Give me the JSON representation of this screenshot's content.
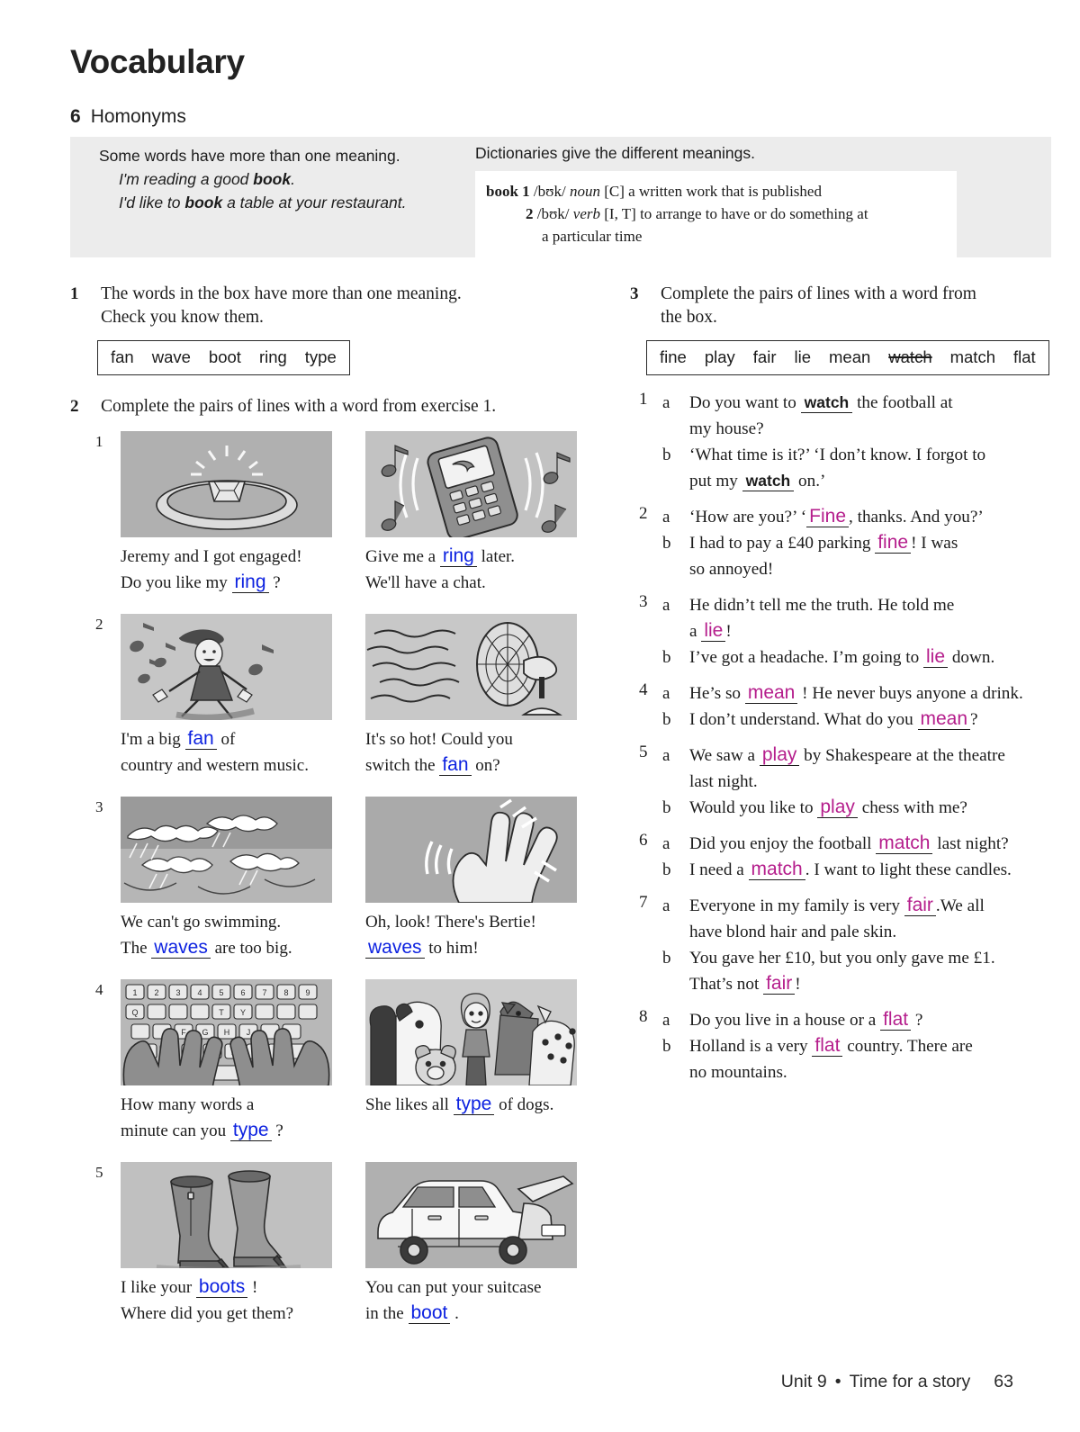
{
  "page": {
    "title": "Vocabulary",
    "section_number": "6",
    "section_title": "Homonyms",
    "footer_unit": "Unit 9",
    "footer_dot": "•",
    "footer_title": "Time for a story",
    "footer_page": "63"
  },
  "presentation": {
    "intro": "Some words have more than one meaning.",
    "example_1_pre": "I'm reading a good ",
    "example_1_bold": "book",
    "example_1_post": ".",
    "example_2_pre": "I'd like to ",
    "example_2_bold": "book",
    "example_2_post": " a table at your restaurant.",
    "dict_intro": "Dictionaries give the different meanings.",
    "dict": {
      "headword": "book",
      "sense1_num": "1",
      "sense1_ipa": "/bʊk/",
      "sense1_pos": "noun",
      "sense1_codes": "[C]",
      "sense1_def": "a written work that is published",
      "sense2_num": "2",
      "sense2_ipa": "/bʊk/",
      "sense2_pos": "verb",
      "sense2_codes": "[I, T]",
      "sense2_def": "to arrange to have or do something at",
      "sense2_def_cont": "a particular time"
    }
  },
  "exercise1": {
    "number": "1",
    "instruction_line1": "The words in the box have more than one meaning.",
    "instruction_line2": "Check you know them.",
    "words": [
      {
        "text": "fan",
        "struck": false
      },
      {
        "text": "wave",
        "struck": false
      },
      {
        "text": "boot",
        "struck": false
      },
      {
        "text": "ring",
        "struck": false
      },
      {
        "text": "type",
        "struck": false
      }
    ]
  },
  "exercise2": {
    "number": "2",
    "instruction": "Complete the pairs of lines with a word from exercise 1.",
    "rows": [
      {
        "row_number": "1",
        "left": {
          "image": "diamond-ring-illustration",
          "caption_line1": "Jeremy and I got engaged!",
          "caption_line2_pre": "Do you like my ",
          "answer": "ring",
          "caption_line2_post": " ?"
        },
        "right": {
          "image": "ringing-mobile-phone-illustration",
          "caption_line1_pre": "Give me a ",
          "answer": "ring",
          "caption_line1_post": " later.",
          "caption_line2": "We'll have a chat."
        }
      },
      {
        "row_number": "2",
        "left": {
          "image": "country-dancer-illustration",
          "caption_line1_pre": "I'm a big ",
          "answer": "fan",
          "caption_line1_post": " of",
          "caption_line2": "country and western music."
        },
        "right": {
          "image": "electric-fan-illustration",
          "caption_line1": "It's so hot! Could you",
          "caption_line2_pre": "switch the ",
          "answer": "fan",
          "caption_line2_post": " on?"
        }
      },
      {
        "row_number": "3",
        "left": {
          "image": "sea-waves-illustration",
          "caption_line1": "We can't go swimming.",
          "caption_line2_pre": "The ",
          "answer": "waves",
          "caption_line2_post": " are too big."
        },
        "right": {
          "image": "waving-hand-illustration",
          "caption_line1": "Oh, look! There's Bertie!",
          "answer": "waves",
          "caption_line2_post": " to him!"
        }
      },
      {
        "row_number": "4",
        "left": {
          "image": "hands-typing-keyboard-illustration",
          "caption_line1": "How many words a",
          "caption_line2_pre": "minute can you ",
          "answer": "type",
          "caption_line2_post": " ?"
        },
        "right": {
          "image": "girl-with-dogs-illustration",
          "caption_line1_pre": "She likes all ",
          "answer": "type",
          "caption_line1_post": " of dogs."
        }
      },
      {
        "row_number": "5",
        "left": {
          "image": "high-heeled-boots-illustration",
          "caption_line1_pre": "I like your ",
          "answer": "boots",
          "caption_line1_post": " !",
          "caption_line2": "Where did you get them?"
        },
        "right": {
          "image": "car-with-open-boot-illustration",
          "caption_line1": "You can put your suitcase",
          "caption_line2_pre": "in the ",
          "answer": "boot",
          "caption_line2_post": " ."
        }
      }
    ]
  },
  "exercise3": {
    "number": "3",
    "instruction_line1": "Complete the pairs of lines with a word from",
    "instruction_line2": "the box.",
    "words": [
      {
        "text": "fine",
        "struck": false
      },
      {
        "text": "play",
        "struck": false
      },
      {
        "text": "fair",
        "struck": false
      },
      {
        "text": "lie",
        "struck": false
      },
      {
        "text": "mean",
        "struck": false
      },
      {
        "text": "watch",
        "struck": true
      },
      {
        "text": "match",
        "struck": false
      },
      {
        "text": "flat",
        "struck": false
      }
    ],
    "items": [
      {
        "number": "1",
        "a": {
          "letter": "a",
          "pre": "Do you want to ",
          "answer": "watch",
          "answer_style": "printed",
          "post": " the football at",
          "line2": "my house?"
        },
        "b": {
          "letter": "b",
          "line1": "‘What time is it?’  ‘I don’t know. I forgot to",
          "pre": "put my ",
          "answer": "watch",
          "answer_style": "printed",
          "post": " on.’"
        }
      },
      {
        "number": "2",
        "a": {
          "letter": "a",
          "pre": "‘How are you?’  ‘",
          "answer": "Fine",
          "answer_style": "magenta",
          "post": ", thanks. And you?’"
        },
        "b": {
          "letter": "b",
          "pre": "I had to pay a £40 parking ",
          "answer": "fine",
          "answer_style": "magenta",
          "post": "! I was",
          "line2": "so annoyed!"
        }
      },
      {
        "number": "3",
        "a": {
          "letter": "a",
          "line1": "He didn’t tell me the truth. He told me",
          "pre": "a ",
          "answer": "lie",
          "answer_style": "magenta",
          "post": "!"
        },
        "b": {
          "letter": "b",
          "pre": "I’ve got a headache. I’m going to ",
          "answer": "lie",
          "answer_style": "magenta",
          "post": " down."
        }
      },
      {
        "number": "4",
        "a": {
          "letter": "a",
          "pre": "He’s so ",
          "answer": "mean",
          "answer_style": "magenta",
          "post": " ! He never buys anyone a drink."
        },
        "b": {
          "letter": "b",
          "pre": "I don’t understand. What do you ",
          "answer": "mean",
          "answer_style": "magenta",
          "post": "?"
        }
      },
      {
        "number": "5",
        "a": {
          "letter": "a",
          "pre": "We saw a ",
          "answer": "play",
          "answer_style": "magenta",
          "post": " by Shakespeare at the theatre",
          "line2": "last night."
        },
        "b": {
          "letter": "b",
          "pre": "Would you like to ",
          "answer": "play",
          "answer_style": "magenta",
          "post": " chess with me?"
        }
      },
      {
        "number": "6",
        "a": {
          "letter": "a",
          "pre": "Did you enjoy the football ",
          "answer": "match",
          "answer_style": "magenta",
          "post": " last night?"
        },
        "b": {
          "letter": "b",
          "pre": "I need a ",
          "answer": "match",
          "answer_style": "magenta",
          "post": ". I want to light these candles."
        }
      },
      {
        "number": "7",
        "a": {
          "letter": "a",
          "pre": "Everyone in my family is very ",
          "answer": "fair",
          "answer_style": "magenta",
          "post": ".We all",
          "line2": "have blond hair and pale skin."
        },
        "b": {
          "letter": "b",
          "line1": "You gave her £10, but you only gave me £1.",
          "pre": "That’s not ",
          "answer": "fair",
          "answer_style": "magenta",
          "post": "!"
        }
      },
      {
        "number": "8",
        "a": {
          "letter": "a",
          "pre": "Do you live in a house or a ",
          "answer": "flat",
          "answer_style": "magenta",
          "post": " ?"
        },
        "b": {
          "letter": "b",
          "pre": "Holland is a very ",
          "answer": "flat",
          "answer_style": "magenta",
          "post": " country. There are",
          "line2": "no mountains."
        }
      }
    ]
  },
  "colors": {
    "answer_blue": "#0d22e0",
    "answer_magenta": "#b51e8c",
    "band_grey": "#ececec",
    "picture_grey": "#b4b4b4"
  }
}
